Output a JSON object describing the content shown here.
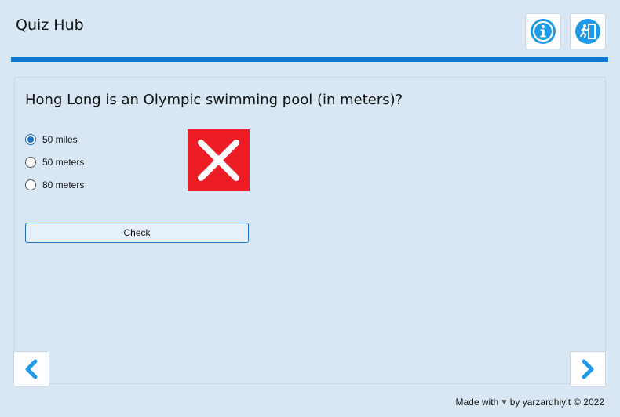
{
  "app": {
    "title": "Quiz Hub"
  },
  "header": {
    "info_icon": "info-icon",
    "exit_icon": "exit-door-icon",
    "accent_color": "#0a78d2"
  },
  "quiz": {
    "question": "Hong Long is an Olympic swimming pool (in meters)?",
    "options": [
      {
        "label": "50 miles",
        "selected": true
      },
      {
        "label": "50 meters",
        "selected": false
      },
      {
        "label": "80 meters",
        "selected": false
      }
    ],
    "result_icon": "wrong-x-icon",
    "result_color": "#ee1c24",
    "check_label": "Check"
  },
  "nav": {
    "prev_icon": "chevron-left-icon",
    "next_icon": "chevron-right-icon"
  },
  "footer": {
    "made_with": "Made with",
    "heart_icon": "heart-icon",
    "by_text": "by yarzardhiyit",
    "copyright": "© 2022"
  }
}
